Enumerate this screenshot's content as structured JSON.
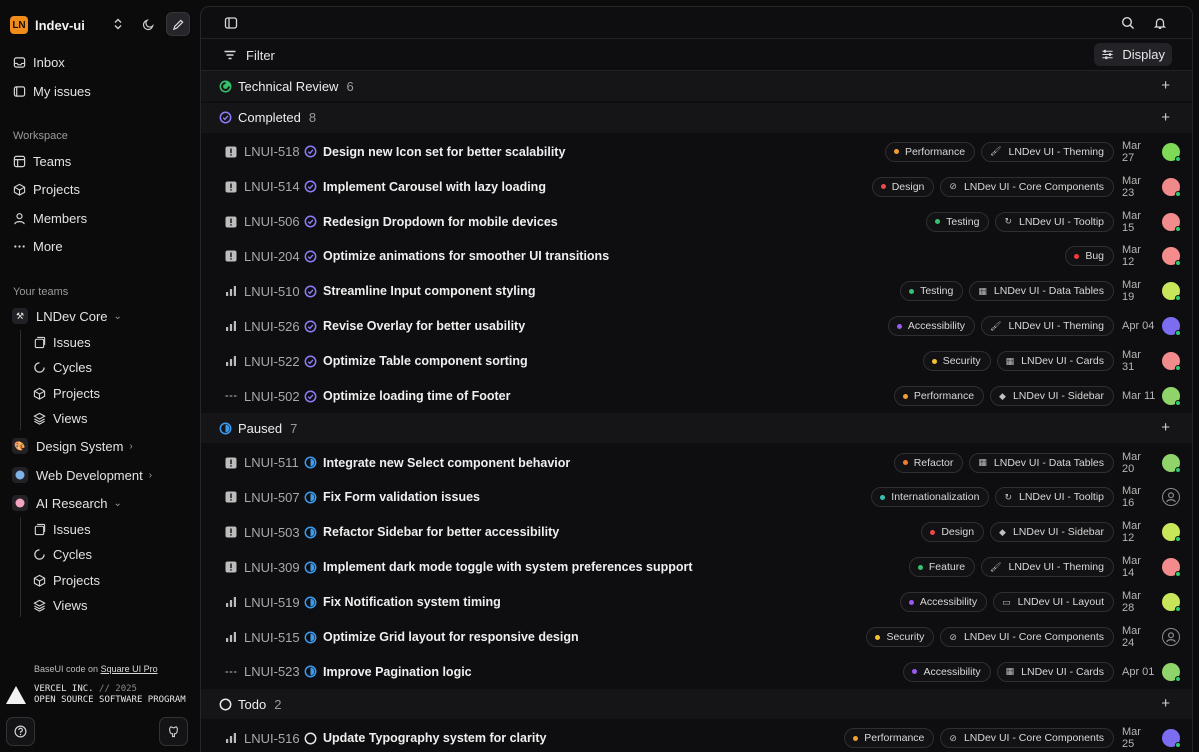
{
  "workspace": {
    "logo_text": "LN",
    "name": "lndev-ui"
  },
  "nav": {
    "inbox": "Inbox",
    "my_issues": "My issues",
    "workspace_label": "Workspace",
    "teams": "Teams",
    "projects": "Projects",
    "members": "Members",
    "more": "More",
    "your_teams_label": "Your teams"
  },
  "teams": [
    {
      "name": "LNDev Core",
      "icon": "tools-icon",
      "expanded": true,
      "children": [
        "Issues",
        "Cycles",
        "Projects",
        "Views"
      ]
    },
    {
      "name": "Design System",
      "icon": "palette-icon",
      "expanded": false
    },
    {
      "name": "Web Development",
      "icon": "globe-icon",
      "expanded": false
    },
    {
      "name": "AI Research",
      "icon": "brain-icon",
      "expanded": true,
      "children": [
        "Issues",
        "Cycles",
        "Projects",
        "Views"
      ]
    }
  ],
  "footer": {
    "note_prefix": "BaseUI code on",
    "note_link": "Square UI Pro",
    "vercel_line1": "VERCEL INC.",
    "vercel_sep": "//",
    "vercel_year": "2025",
    "vercel_line2": "OPEN SOURCE SOFTWARE PROGRAM"
  },
  "toolbar": {
    "filter_label": "Filter",
    "display_label": "Display"
  },
  "colors": {
    "review": "#36c26b",
    "completed": "#8b7cf6",
    "paused": "#3b9bf0",
    "todo": "#e6e6e6",
    "urgent": "#c9c9c9"
  },
  "groups": [
    {
      "key": "review",
      "title": "Technical Review",
      "count": "6",
      "issues": []
    },
    {
      "key": "completed",
      "title": "Completed",
      "count": "8",
      "issues": [
        {
          "id": "LNUI-518",
          "priority": "urgent",
          "title": "Design new Icon set for better scalability",
          "label": "Performance",
          "label_color": "#f0a030",
          "project": "LNDev UI - Theming",
          "project_icon": "brush-icon",
          "date": "Mar 27",
          "avatar": "#7ed957"
        },
        {
          "id": "LNUI-514",
          "priority": "urgent",
          "title": "Implement Carousel with lazy loading",
          "label": "Design",
          "label_color": "#e84a4a",
          "project": "LNDev UI - Core Components",
          "project_icon": "component-icon",
          "date": "Mar 23",
          "avatar": "#f08a8a"
        },
        {
          "id": "LNUI-506",
          "priority": "urgent",
          "title": "Redesign Dropdown for mobile devices",
          "label": "Testing",
          "label_color": "#38c172",
          "project": "LNDev UI - Tooltip",
          "project_icon": "refresh-icon",
          "date": "Mar 15",
          "avatar": "#f28b8b"
        },
        {
          "id": "LNUI-204",
          "priority": "urgent",
          "title": "Optimize animations for smoother UI transitions",
          "label": "Bug",
          "label_color": "#ef3b3b",
          "project": "",
          "project_icon": "",
          "date": "Mar 12",
          "avatar": "#f48c8c"
        },
        {
          "id": "LNUI-510",
          "priority": "high",
          "title": "Streamline Input component styling",
          "label": "Testing",
          "label_color": "#38c172",
          "project": "LNDev UI - Data Tables",
          "project_icon": "table-icon",
          "date": "Mar 19",
          "avatar": "#c8e65a"
        },
        {
          "id": "LNUI-526",
          "priority": "high",
          "title": "Revise Overlay for better usability",
          "label": "Accessibility",
          "label_color": "#9b59f0",
          "project": "LNDev UI - Theming",
          "project_icon": "brush-icon",
          "date": "Apr 04",
          "avatar": "#7b6cf0"
        },
        {
          "id": "LNUI-522",
          "priority": "high",
          "title": "Optimize Table component sorting",
          "label": "Security",
          "label_color": "#f0c230",
          "project": "LNDev UI - Cards",
          "project_icon": "table-icon",
          "date": "Mar 31",
          "avatar": "#f28b8b"
        },
        {
          "id": "LNUI-502",
          "priority": "none",
          "title": "Optimize loading time of Footer",
          "label": "Performance",
          "label_color": "#f0a030",
          "project": "LNDev UI - Sidebar",
          "project_icon": "shapes-icon",
          "date": "Mar 11",
          "avatar": "#8fd46a"
        }
      ]
    },
    {
      "key": "paused",
      "title": "Paused",
      "count": "7",
      "issues": [
        {
          "id": "LNUI-511",
          "priority": "urgent",
          "title": "Integrate new Select component behavior",
          "label": "Refactor",
          "label_color": "#f07a30",
          "project": "LNDev UI - Data Tables",
          "project_icon": "table-icon",
          "date": "Mar 20",
          "avatar": "#8fd46a"
        },
        {
          "id": "LNUI-507",
          "priority": "urgent",
          "title": "Fix Form validation issues",
          "label": "Internationalization",
          "label_color": "#38c1b0",
          "project": "LNDev UI - Tooltip",
          "project_icon": "refresh-icon",
          "date": "Mar 16",
          "avatar": ""
        },
        {
          "id": "LNUI-503",
          "priority": "urgent",
          "title": "Refactor Sidebar for better accessibility",
          "label": "Design",
          "label_color": "#e84a4a",
          "project": "LNDev UI - Sidebar",
          "project_icon": "shapes-icon",
          "date": "Mar 12",
          "avatar": "#c8e65a"
        },
        {
          "id": "LNUI-309",
          "priority": "urgent",
          "title": "Implement dark mode toggle with system preferences support",
          "label": "Feature",
          "label_color": "#38c172",
          "project": "LNDev UI - Theming",
          "project_icon": "brush-icon",
          "date": "Mar 14",
          "avatar": "#f28b8b"
        },
        {
          "id": "LNUI-519",
          "priority": "high",
          "title": "Fix Notification system timing",
          "label": "Accessibility",
          "label_color": "#9b59f0",
          "project": "LNDev UI - Layout",
          "project_icon": "layout-icon",
          "date": "Mar 28",
          "avatar": "#c8e65a"
        },
        {
          "id": "LNUI-515",
          "priority": "high",
          "title": "Optimize Grid layout for responsive design",
          "label": "Security",
          "label_color": "#f0c230",
          "project": "LNDev UI - Core Components",
          "project_icon": "component-icon",
          "date": "Mar 24",
          "avatar": ""
        },
        {
          "id": "LNUI-523",
          "priority": "none",
          "title": "Improve Pagination logic",
          "label": "Accessibility",
          "label_color": "#9b59f0",
          "project": "LNDev UI - Cards",
          "project_icon": "table-icon",
          "date": "Apr 01",
          "avatar": "#8fd46a"
        }
      ]
    },
    {
      "key": "todo",
      "title": "Todo",
      "count": "2",
      "issues": [
        {
          "id": "LNUI-516",
          "priority": "high",
          "title": "Update Typography system for clarity",
          "label": "Performance",
          "label_color": "#f0a030",
          "project": "LNDev UI - Core Components",
          "project_icon": "component-icon",
          "date": "Mar 25",
          "avatar": "#7b6cf0"
        }
      ]
    }
  ]
}
